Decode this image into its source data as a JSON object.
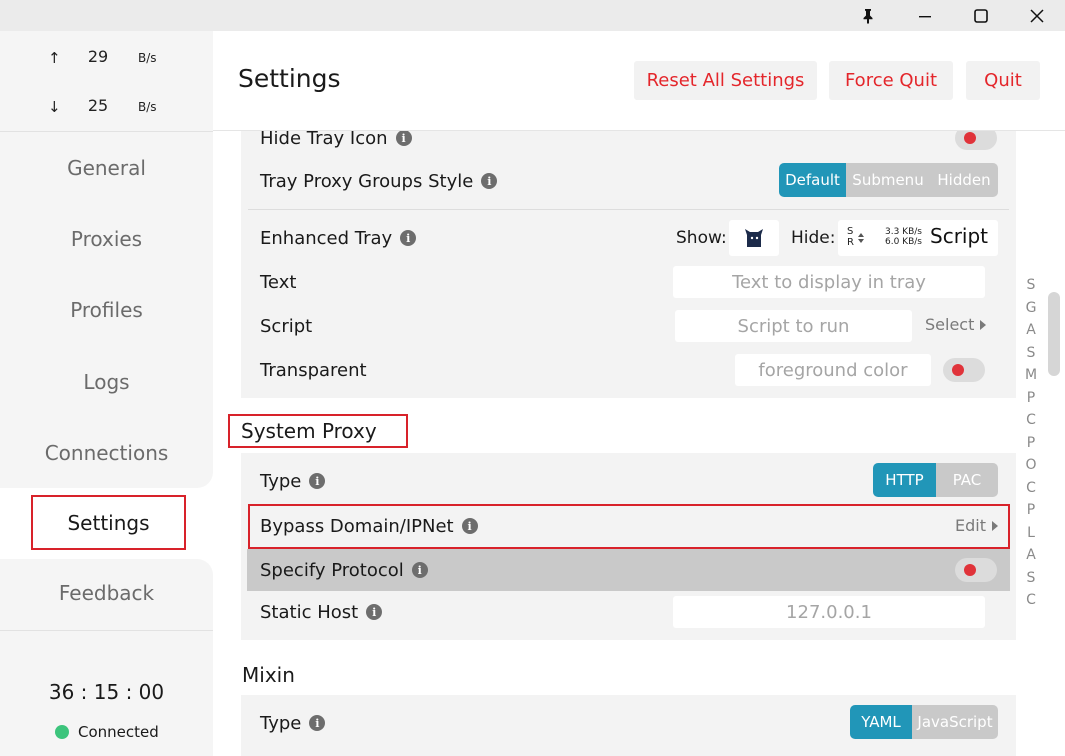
{
  "window": {
    "pin_icon": "pin-icon",
    "minimize_icon": "minimize-icon",
    "maximize_icon": "maximize-icon",
    "close_icon": "close-icon"
  },
  "traffic": {
    "up_arrow": "↑",
    "up_value": "29",
    "up_unit": "B/s",
    "down_arrow": "↓",
    "down_value": "25",
    "down_unit": "B/s"
  },
  "sidebar": {
    "items": [
      {
        "label": "General"
      },
      {
        "label": "Proxies"
      },
      {
        "label": "Profiles"
      },
      {
        "label": "Logs"
      },
      {
        "label": "Connections"
      },
      {
        "label": "Settings"
      },
      {
        "label": "Feedback"
      }
    ],
    "timer": "36 : 15 : 00",
    "status": "Connected",
    "status_color": "#3cc47c"
  },
  "header": {
    "title": "Settings",
    "reset_label": "Reset All Settings",
    "force_quit_label": "Force Quit",
    "quit_label": "Quit"
  },
  "tray": {
    "hide_icon_label": "Hide Tray Icon",
    "groups_style_label": "Tray Proxy Groups Style",
    "groups_style_options": [
      "Default",
      "Submenu",
      "Hidden"
    ],
    "groups_style_selected": "Default",
    "enhanced_label": "Enhanced Tray",
    "show_label": "Show:",
    "hide_label": "Hide:",
    "preview_s": "S",
    "preview_r": "R",
    "preview_up": "3.3 KB/s",
    "preview_down": "6.0 KB/s",
    "preview_script": "Script",
    "text_label": "Text",
    "text_placeholder": "Text to display in tray",
    "script_label": "Script",
    "script_placeholder": "Script to run",
    "select_label": "Select",
    "transparent_label": "Transparent",
    "foreground_placeholder": "foreground color"
  },
  "system_proxy": {
    "title": "System Proxy",
    "type_label": "Type",
    "type_options": [
      "HTTP",
      "PAC"
    ],
    "type_selected": "HTTP",
    "bypass_label": "Bypass Domain/IPNet",
    "edit_label": "Edit",
    "specify_label": "Specify Protocol",
    "static_host_label": "Static Host",
    "static_host_value": "127.0.0.1"
  },
  "mixin": {
    "title": "Mixin",
    "type_label": "Type",
    "type_options": [
      "YAML",
      "JavaScript"
    ],
    "type_selected": "YAML"
  },
  "index": [
    "S",
    "G",
    "A",
    "S",
    "M",
    "P",
    "C",
    "P",
    "O",
    "C",
    "P",
    "L",
    "A",
    "S",
    "C"
  ],
  "colors": {
    "accent": "#2196b8",
    "danger": "#e4262b",
    "highlight_border": "#d8222a",
    "toggle_knob": "#e0333a"
  }
}
